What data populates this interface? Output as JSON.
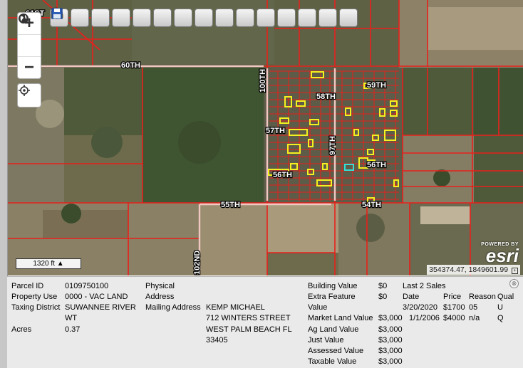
{
  "map": {
    "road_labels": [
      "61ST",
      "60TH",
      "59TH",
      "58TH",
      "57TH",
      "56TH",
      "56TH",
      "55TH",
      "54TH",
      "100TH",
      "97TH",
      "102ND"
    ],
    "scale_label": "1320 ft",
    "powered_by": "POWERED BY",
    "logo_text": "esri",
    "coordinates": "354374.47, 1849601.99",
    "colors": {
      "parcel_lines": "#e8201b",
      "highlight": "#f4f11e",
      "selected": "#2ee0d8"
    }
  },
  "toolbar": {
    "buttons": [
      "info-icon",
      "select-icon",
      "zoom-in-icon",
      "pan-icon",
      "eraser-icon",
      "add-point-icon",
      "marker-icon",
      "layers-icon",
      "measure-icon",
      "search-icon",
      "pencil-icon",
      "print-icon",
      "settings-icon",
      "driving-icon",
      "save-icon"
    ]
  },
  "zoom_controls": {
    "zoom_in": "+",
    "globe": "globe-icon",
    "zoom_out": "−",
    "locate": "locate-icon"
  },
  "info": {
    "parcel_id_label": "Parcel ID",
    "parcel_id": "0109750100",
    "property_use_label": "Property Use",
    "property_use": "0000 - VAC LAND",
    "taxing_district_label": "Taxing District",
    "taxing_district_1": "SUWANNEE RIVER",
    "taxing_district_2": "WT",
    "acres_label": "Acres",
    "acres": "0.37",
    "physical_label": "Physical",
    "address_label": "Address",
    "mailing_label": "Mailing Address",
    "mailing_1": "KEMP MICHAEL",
    "mailing_2": "712 WINTERS STREET",
    "mailing_3": "WEST PALM BEACH FL",
    "mailing_4": "33405",
    "building_value_label": "Building Value",
    "building_value": "$0",
    "extra_feature_label": "Extra Feature",
    "extra_feature": "$0",
    "value_label": "Value",
    "market_land_label": "Market Land Value",
    "market_land": "$3,000",
    "ag_land_label": "Ag Land Value",
    "ag_land": "$3,000",
    "just_value_label": "Just Value",
    "just_value": "$3,000",
    "assessed_label": "Assessed Value",
    "assessed": "$3,000",
    "taxable_label": "Taxable Value",
    "taxable": "$3,000",
    "sales_title": "Last 2 Sales",
    "sales_headers": [
      "Date",
      "Price",
      "Reason",
      "Qual"
    ],
    "sales": [
      {
        "date": "3/20/2020",
        "price": "$1700",
        "reason": "05",
        "qual": "U"
      },
      {
        "date": "1/1/2006",
        "price": "$4000",
        "reason": "n/a",
        "qual": "Q"
      }
    ],
    "close": "⊗"
  }
}
